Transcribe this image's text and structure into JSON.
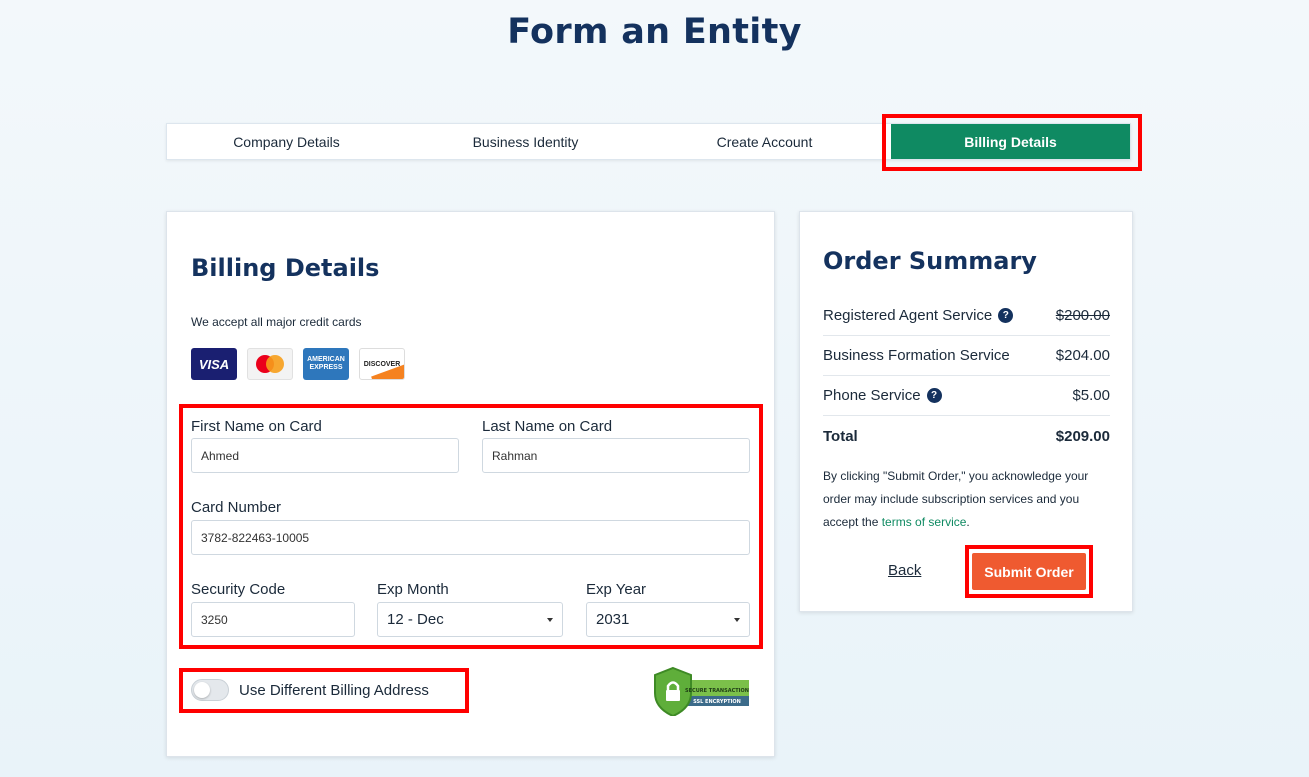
{
  "page": {
    "title": "Form an Entity"
  },
  "steps": [
    {
      "label": "Company Details",
      "active": false
    },
    {
      "label": "Business Identity",
      "active": false
    },
    {
      "label": "Create Account",
      "active": false
    },
    {
      "label": "Billing Details",
      "active": true
    }
  ],
  "billing": {
    "title": "Billing Details",
    "accept_text": "We accept all major credit cards",
    "card_logos": [
      {
        "name": "visa-logo",
        "text": "VISA"
      },
      {
        "name": "mastercard-logo",
        "text": ""
      },
      {
        "name": "amex-logo",
        "text": "AMERICAN EXPRESS"
      },
      {
        "name": "discover-logo",
        "text": "DISCOVER"
      }
    ],
    "first_name": {
      "label": "First Name on Card",
      "value": "Ahmed"
    },
    "last_name": {
      "label": "Last Name on Card",
      "value": "Rahman"
    },
    "card_number": {
      "label": "Card Number",
      "value": "3782-822463-10005"
    },
    "security_code": {
      "label": "Security Code",
      "value": "3250"
    },
    "exp_month": {
      "label": "Exp Month",
      "value": "12 - Dec"
    },
    "exp_year": {
      "label": "Exp Year",
      "value": "2031"
    },
    "diff_address": {
      "label": "Use Different Billing Address",
      "enabled": false
    },
    "secure_badge": {
      "line1": "SECURE TRANSACTION",
      "line2": "SSL ENCRYPTION"
    }
  },
  "order": {
    "title": "Order Summary",
    "items": [
      {
        "name": "Registered Agent Service",
        "price": "$200.00",
        "help": true,
        "strike": true
      },
      {
        "name": "Business Formation Service",
        "price": "$204.00",
        "help": false,
        "strike": false
      },
      {
        "name": "Phone Service",
        "price": "$5.00",
        "help": true,
        "strike": false
      }
    ],
    "total_label": "Total",
    "total_value": "$209.00",
    "ack_pre": "By clicking \"Submit Order,\" you acknowledge your order may include subscription services and you accept the ",
    "ack_link": "terms of service",
    "ack_post": ".",
    "back_label": "Back",
    "submit_label": "Submit Order"
  },
  "colors": {
    "brand_navy": "#14325e",
    "brand_green": "#0f8a62",
    "submit_orange": "#ef5a30",
    "highlight_red": "#ff0000"
  }
}
